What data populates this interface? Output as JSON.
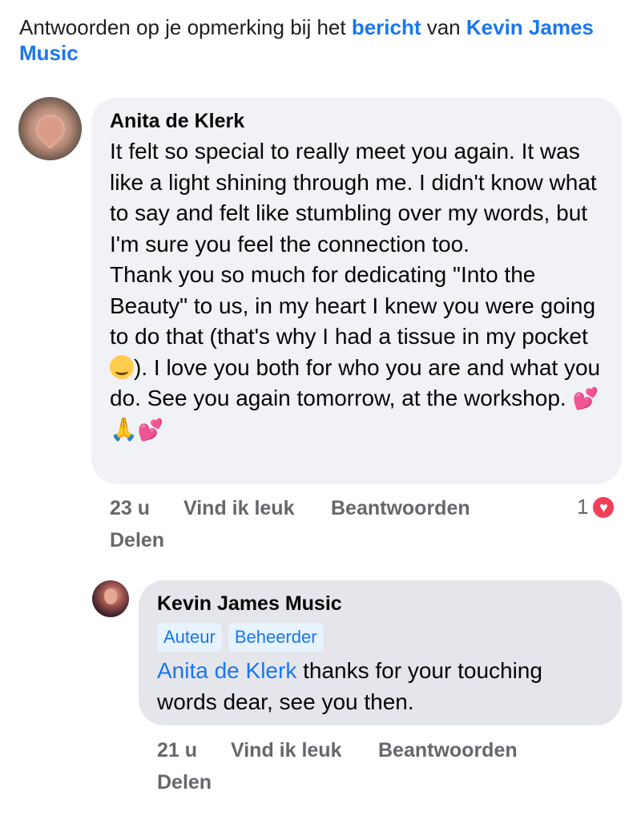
{
  "header": {
    "prefix": "Antwoorden op je opmerking bij het ",
    "link_post": "bericht",
    "middle": " van ",
    "link_page": "Kevin James Music"
  },
  "comment": {
    "author": "Anita de Klerk",
    "text_part1": "It felt so special to really meet you again. It was like a light shining through me. I didn't know what to say and felt like stumbling over my words, but I'm sure you feel the connection too.\nThank you so much for dedicating \"Into the Beauty\" to us, in my heart I knew you were going to do that (that's why I had a tissue in my pocket ",
    "text_part2": "). I love you both for who you are and what you do. See you again tomorrow, at the workshop. ",
    "emoji_end_1": "💕",
    "emoji_end_2": "🙏",
    "emoji_end_3": "💕",
    "emoji_inline_name": "smiling-face-emoji",
    "time": "23 u",
    "like_label": "Vind ik leuk",
    "reply_label": "Beantwoorden",
    "share_label": "Delen",
    "reaction_count": "1",
    "reaction_icon": "heart-icon",
    "reaction_color": "#f33e58"
  },
  "reply": {
    "author": "Kevin James Music",
    "badge_author": "Auteur",
    "badge_admin": "Beheerder",
    "mention": "Anita de Klerk",
    "text": " thanks for your touching words dear, see you then.",
    "time": "21 u",
    "like_label": "Vind ik leuk",
    "reply_label": "Beantwoorden",
    "share_label": "Delen"
  },
  "colors": {
    "link": "#1877f2",
    "bubble_comment": "#f0f2f5",
    "bubble_reply": "#e4e6eb",
    "secondary_text": "#65676b"
  }
}
